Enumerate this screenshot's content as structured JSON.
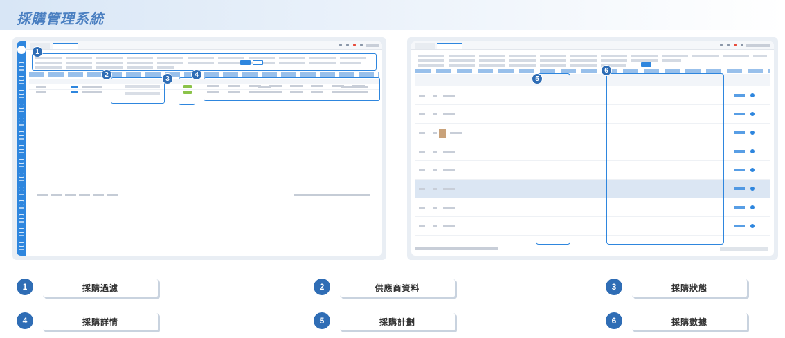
{
  "page": {
    "title": "採購管理系統"
  },
  "markers": [
    "1",
    "2",
    "3",
    "4",
    "5",
    "6"
  ],
  "legend": [
    {
      "num": "1",
      "label": "採購過濾"
    },
    {
      "num": "2",
      "label": "供應商資料"
    },
    {
      "num": "3",
      "label": "採購狀態"
    },
    {
      "num": "4",
      "label": "採購詳情"
    },
    {
      "num": "5",
      "label": "採購計劃"
    },
    {
      "num": "6",
      "label": "採購數據"
    }
  ],
  "colors": {
    "accent": "#2f6db5",
    "title": "#4a7fc1",
    "sidebar": "#2e86de"
  }
}
